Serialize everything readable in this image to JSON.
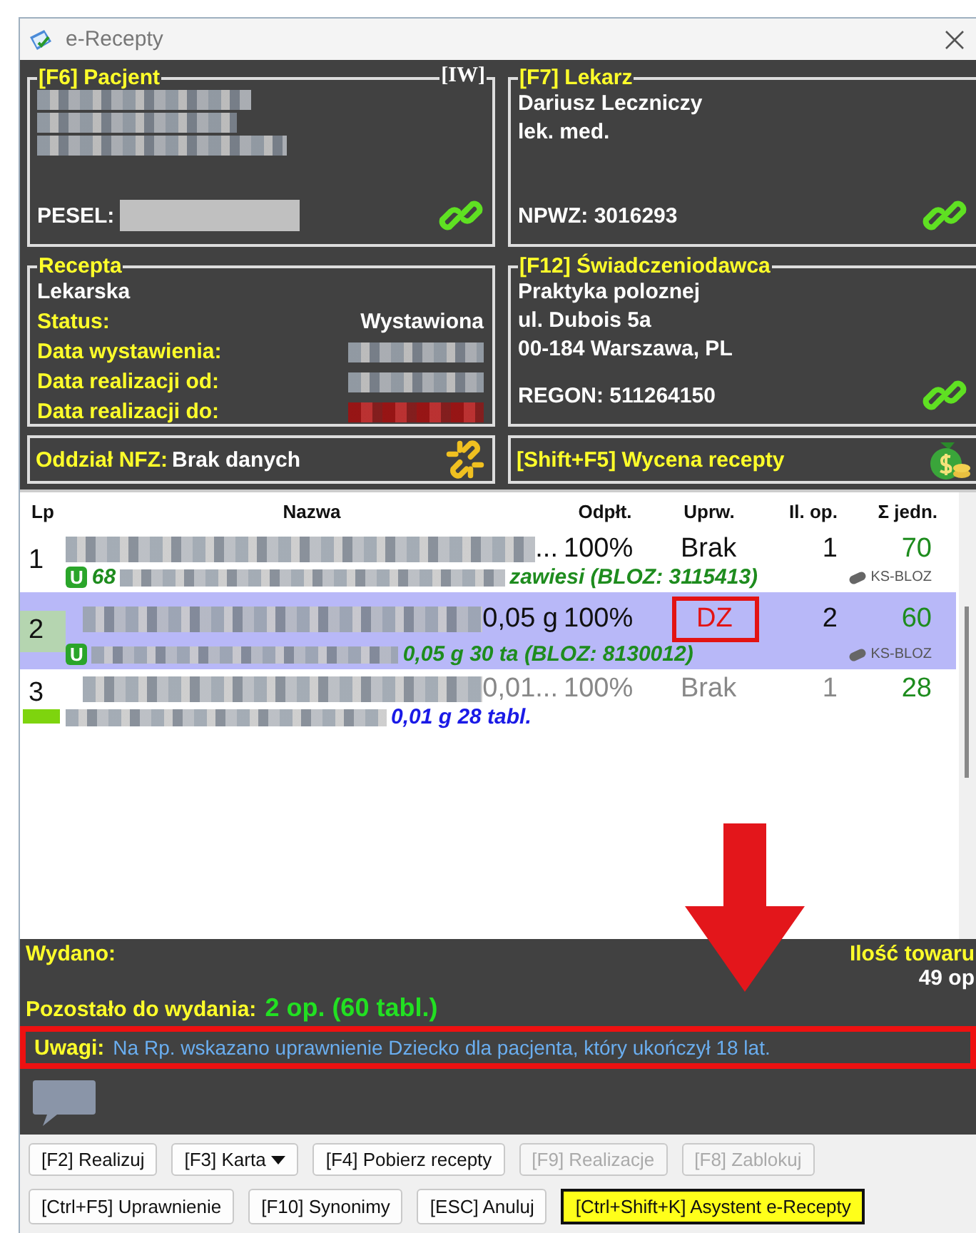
{
  "window": {
    "title": "e-Recepty"
  },
  "patient": {
    "title": "[F6] Pacjent",
    "tag": "[IW]",
    "pesel_label": "PESEL:",
    "linked": true
  },
  "doctor": {
    "title": "[F7] Lekarz",
    "lines": [
      "Dariusz Leczniczy",
      "lek. med."
    ],
    "id_line": "NPWZ: 3016293",
    "linked": true
  },
  "prescription": {
    "title": "Recepta",
    "type": "Lekarska",
    "status_label": "Status:",
    "status_value": "Wystawiona",
    "dates": [
      {
        "label": "Data wystawienia:",
        "alert": false
      },
      {
        "label": "Data realizacji od:",
        "alert": false
      },
      {
        "label": "Data realizacji do:",
        "alert": true
      }
    ]
  },
  "provider": {
    "title": "[F12] Świadczeniodawca",
    "lines": [
      "Praktyka poloznej",
      "ul. Dubois 5a",
      "00-184 Warszawa, PL"
    ],
    "id_line": "REGON: 511264150",
    "linked": true
  },
  "nfz": {
    "label": "Oddział NFZ:",
    "value": "Brak danych",
    "linked": false
  },
  "pricing": {
    "label": "[Shift+F5] Wycena recepty"
  },
  "table": {
    "columns": [
      "Lp",
      "Nazwa",
      "Odpłt.",
      "Uprw.",
      "Il. op.",
      "Σ jedn."
    ],
    "rows": [
      {
        "lp": "1",
        "name_tail": "...",
        "refund": "100%",
        "entitlement": "Brak",
        "packages": "1",
        "units": "70",
        "badge": "U",
        "sub_prefix": "68",
        "sub_suffix": "zawiesi (BLOZ: 3115413)",
        "color": "#1e8c1e",
        "source": "KS-BLOZ",
        "selected": false,
        "dimmed": false,
        "flagged": false
      },
      {
        "lp": "2",
        "name_tail": "0,05 g",
        "refund": "100%",
        "entitlement": "DZ",
        "packages": "2",
        "units": "60",
        "badge": "U",
        "sub_suffix": "0,05 g 30 ta (BLOZ: 8130012)",
        "color": "#1e8c1e",
        "source": "KS-BLOZ",
        "selected": true,
        "dimmed": false,
        "flagged": true
      },
      {
        "lp": "3",
        "name_tail": "0,01...",
        "refund": "100%",
        "entitlement": "Brak",
        "packages": "1",
        "units": "28",
        "sub_suffix": "0,01 g 28 tabl.",
        "color": "#1a1ae6",
        "selected": false,
        "dimmed": true,
        "flagged": false
      }
    ]
  },
  "summary": {
    "dispensed_label": "Wydano:",
    "stock_label": "Ilość towaru",
    "stock_value": "49 op",
    "remaining_label": "Pozostało do wydania:",
    "remaining_value": "2 op. (60 tabl.)"
  },
  "notes": {
    "label": "Uwagi:",
    "text": "Na Rp. wskazano uprawnienie Dziecko dla pacjenta, który ukończył 18 lat.",
    "flagged": true
  },
  "buttons": [
    [
      {
        "label": "[F2] Realizuj",
        "disabled": false,
        "kind": "normal"
      },
      {
        "label": "[F3] Karta",
        "disabled": false,
        "kind": "dropdown"
      },
      {
        "label": "[F4] Pobierz recepty",
        "disabled": false,
        "kind": "normal"
      },
      {
        "label": "[F9] Realizacje",
        "disabled": true,
        "kind": "normal"
      },
      {
        "label": "[F8] Zablokuj",
        "disabled": true,
        "kind": "normal"
      }
    ],
    [
      {
        "label": "[Ctrl+F5] Uprawnienie",
        "disabled": false,
        "kind": "normal"
      },
      {
        "label": "[F10] Synonimy",
        "disabled": false,
        "kind": "normal"
      },
      {
        "label": "[ESC] Anuluj",
        "disabled": false,
        "kind": "normal"
      },
      {
        "label": "[Ctrl+Shift+K] Asystent e-Recepty",
        "disabled": false,
        "kind": "accent"
      }
    ]
  ]
}
